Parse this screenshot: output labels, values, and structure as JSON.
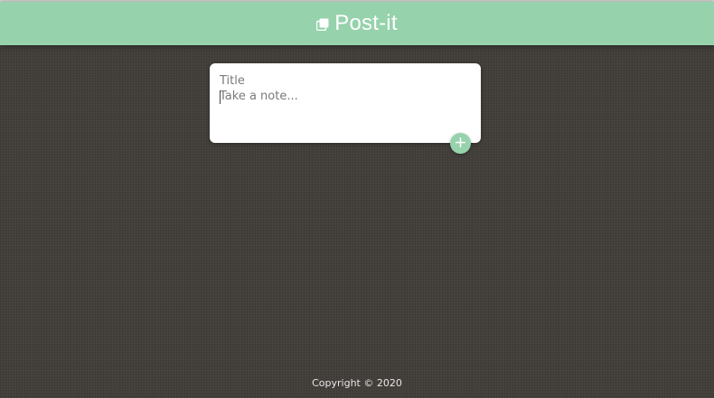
{
  "colors": {
    "accent": "#96d2ab",
    "background": "#433f3b",
    "card": "#ffffff",
    "footer_text": "#e6e6e6"
  },
  "header": {
    "icon": "sticky-notes-icon",
    "title": "Post-it"
  },
  "note_form": {
    "title_placeholder": "Title",
    "title_value": "",
    "content_placeholder": "Take a note...",
    "content_value": "",
    "add_button_icon": "plus-icon"
  },
  "footer": {
    "text": "Copyright © 2020"
  }
}
